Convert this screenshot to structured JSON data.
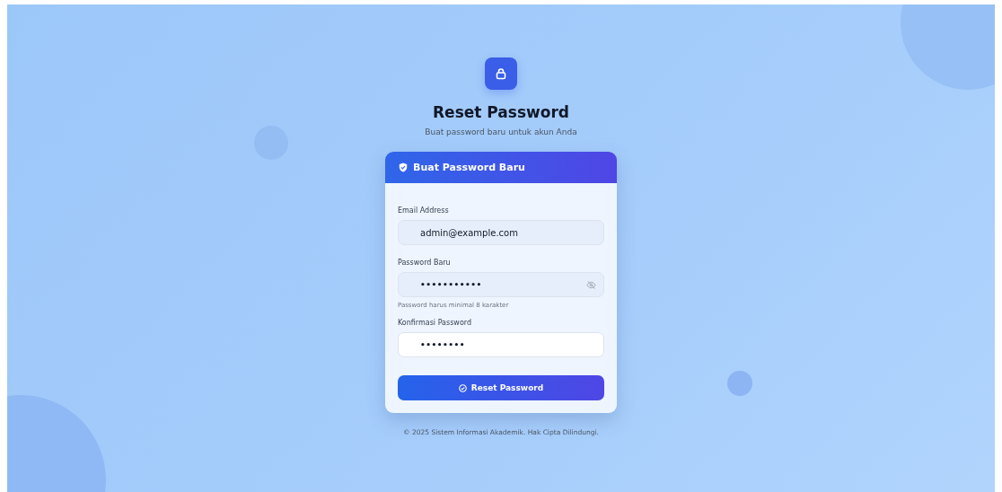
{
  "header": {
    "title": "Reset Password",
    "subtitle": "Buat password baru untuk akun Anda"
  },
  "card": {
    "title": "Buat Password Baru",
    "fields": [
      {
        "label": "Email Address",
        "value": "admin@example.com",
        "focused": false,
        "kind": "text"
      },
      {
        "label": "Password Baru",
        "value": "•••••••••••",
        "focused": false,
        "kind": "password",
        "hint": "Password harus minimal 8 karakter"
      },
      {
        "label": "Konfirmasi Password",
        "value": "••••••••",
        "focused": true,
        "kind": "confirm"
      }
    ],
    "button": "Reset Password"
  },
  "footer": "© 2025 Sistem Informasi Akademik. Hak Cipta Dilindungi."
}
